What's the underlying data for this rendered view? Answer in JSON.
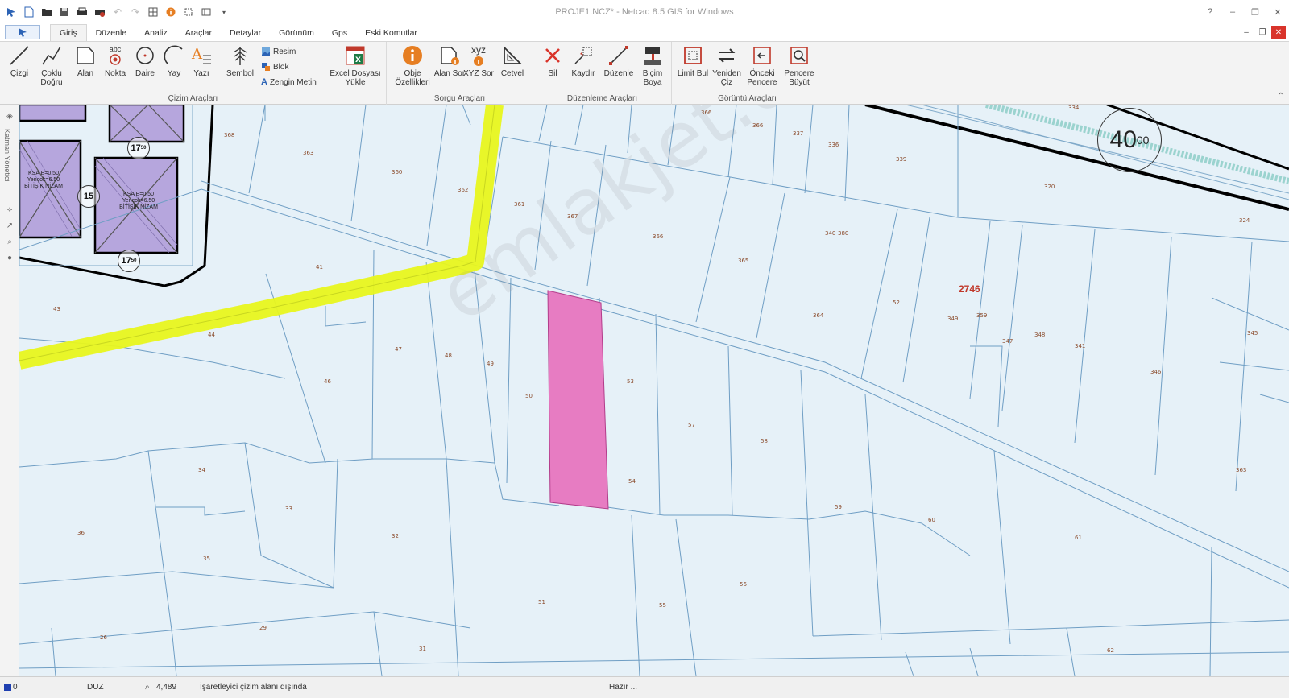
{
  "titlebar": {
    "title": "PROJE1.NCZ* - Netcad 8.5 GIS for Windows",
    "help": "?",
    "minimize": "–",
    "restore": "❐",
    "close": "✕"
  },
  "tabs": [
    {
      "label": "Giriş",
      "active": true
    },
    {
      "label": "Düzenle"
    },
    {
      "label": "Analiz"
    },
    {
      "label": "Araçlar"
    },
    {
      "label": "Detaylar"
    },
    {
      "label": "Görünüm"
    },
    {
      "label": "Gps"
    },
    {
      "label": "Eski Komutlar"
    }
  ],
  "ribbon": {
    "cizim": {
      "label": "Çizim Araçları",
      "cizgi": "Çizgi",
      "coklu": "Çoklu Doğru",
      "alan": "Alan",
      "nokta": "Nokta",
      "daire": "Daire",
      "yay": "Yay",
      "yazi": "Yazı",
      "sembol": "Sembol",
      "resim": "Resim",
      "blok": "Blok",
      "zengin": "Zengin Metin",
      "excel": "Excel Dosyası Yükle",
      "abc": "abc"
    },
    "sorgu": {
      "label": "Sorgu Araçları",
      "obje": "Obje Özellikleri",
      "alan_sor": "Alan Sor",
      "xyz_sor": "XYZ Sor",
      "xyz_text": "xyz",
      "cetvel": "Cetvel"
    },
    "duzenleme": {
      "label": "Düzenleme Araçları",
      "sil": "Sil",
      "kaydir": "Kaydır",
      "duzenle": "Düzenle",
      "bicim": "Biçim Boya"
    },
    "goruntu": {
      "label": "Görüntü Araçları",
      "limit": "Limit Bul",
      "yeniden": "Yeniden Çiz",
      "onceki": "Önceki Pencere",
      "buyut": "Pencere Büyüt"
    }
  },
  "side": {
    "label": "Katman Yönetici"
  },
  "map": {
    "block_number": "2746",
    "watermark": "emlakjet.com",
    "speed": "40",
    "speed_sup": "00",
    "road_badges": [
      {
        "value": "17",
        "sup": "50"
      },
      {
        "value": "15",
        "sup": ""
      },
      {
        "value": "17",
        "sup": "50"
      }
    ],
    "zone_label_1": "KSA E=0.50 Yençok=6.50 BİTİŞİK NİZAM",
    "zone_label_2": "KSA E=0.50 Yençok=6.50 BİTİŞİK NİZAM",
    "parcels": [
      "368",
      "363",
      "360",
      "362",
      "361",
      "367",
      "366",
      "365",
      "364",
      "366",
      "366",
      "337",
      "336",
      "339",
      "320",
      "334",
      "324",
      "41",
      "43",
      "44",
      "47",
      "48",
      "49",
      "46",
      "50",
      "53",
      "52",
      "57",
      "58",
      "54",
      "59",
      "60",
      "61",
      "56",
      "55",
      "51",
      "32",
      "33",
      "34",
      "35",
      "36",
      "29",
      "26",
      "31",
      "62",
      "349",
      "345",
      "363",
      "359",
      "348",
      "347",
      "346",
      "341",
      "340",
      "380"
    ]
  },
  "status": {
    "layer": "0",
    "mode": "DUZ",
    "zoom": "4,489",
    "message": "İşaretleyici çizim alanı dışında",
    "ready": "Hazır ..."
  }
}
